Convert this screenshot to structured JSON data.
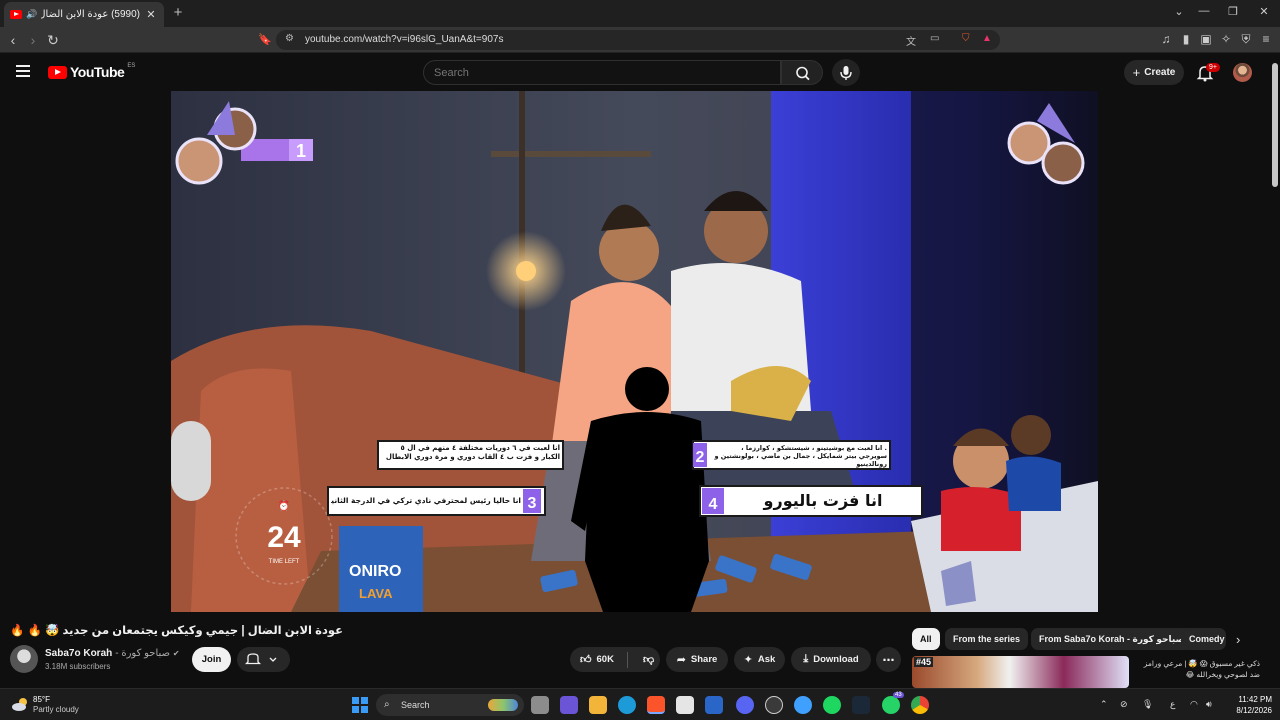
{
  "browser": {
    "tab_title": "(5990) عودة الابن الضال | جيمي",
    "url": "youtube.com/watch?v=i96slG_UanA&t=907s"
  },
  "masthead": {
    "logo_text": "YouTube",
    "country_code": "ES",
    "search_placeholder": "Search",
    "create_label": "Create",
    "notification_count": "9+"
  },
  "video": {
    "title": "عودة الابن الضال | جيمي وكيكس يجتمعان من جديد 🤯 🔥 🔥",
    "timer_value": "24",
    "timer_label": "TIME LEFT",
    "overlay_rank_top": "1",
    "overlay_line_1": ". انا لعبت مع بوشيتينو ، شيستشكو ، كوارزما ، سويرجي بيتر شمايكل ، جمال بن ماضي ، بولونشتين و رونالدينيو",
    "overlay_line_2": "انا لعبت في ٦ دوريات مختلفة ٤ منهم في ال ٥ الكبار و فزت ب ٤ القاب دوري و مرة دوري الابطال",
    "overlay_line_3": "انا حاليا رئيس لمحترفي نادي تركي في الدرجة الثانية",
    "overlay_line_4": "انا فزت باليورو",
    "num_2": "2",
    "num_3": "3",
    "num_4": "4",
    "bag_brand": "ONIRO",
    "bag_sub": "LAVA"
  },
  "channel": {
    "name": "Saba7o Korah",
    "name_ar": "- صباحو كورة",
    "subscribers": "3.18M subscribers",
    "join_label": "Join"
  },
  "actions": {
    "likes": "60K",
    "share_label": "Share",
    "ask_label": "Ask",
    "download_label": "Download"
  },
  "chips": [
    "All",
    "From the series",
    "From Saba7o Korah - صباحو كورة",
    "Comedy"
  ],
  "recommendation": {
    "episode": "#45",
    "title": "ذكي غير مسبوق 😱 🤯 | مرعي ورامز",
    "subtitle": "ضد لصوحي ويخرالله 😂"
  },
  "taskbar": {
    "temperature": "85°F",
    "condition": "Partly cloudy",
    "search_label": "Search",
    "time": "11:42 PM",
    "date": "8/12/2026",
    "lang": "ع",
    "whatsapp_badge": "43"
  }
}
